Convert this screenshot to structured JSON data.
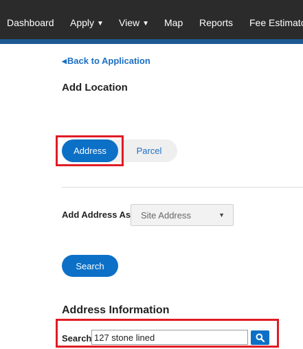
{
  "nav": {
    "items": [
      {
        "label": "Dashboard"
      },
      {
        "label": "Apply"
      },
      {
        "label": "View"
      },
      {
        "label": "Map"
      },
      {
        "label": "Reports"
      },
      {
        "label": "Fee Estimator"
      }
    ],
    "dropdown_icon": "caret-down-icon"
  },
  "back_link": {
    "label": "Back to Application",
    "icon": "triangle-left-icon"
  },
  "page": {
    "title": "Add Location"
  },
  "location_type": {
    "options": [
      {
        "label": "Address",
        "selected": true
      },
      {
        "label": "Parcel",
        "selected": false
      }
    ]
  },
  "add_address_as": {
    "label": "Add Address As",
    "selected": "Site Address"
  },
  "search_button": {
    "label": "Search"
  },
  "address_info": {
    "heading": "Address Information",
    "search_label": "Search",
    "search_value": "127 stone lined",
    "search_icon": "magnifier-icon"
  },
  "colors": {
    "navbar": "#2b2b2b",
    "navbar_accent": "#1d5a93",
    "primary": "#0c70c7",
    "link": "#1a6fc4",
    "highlight": "#e01b24"
  }
}
